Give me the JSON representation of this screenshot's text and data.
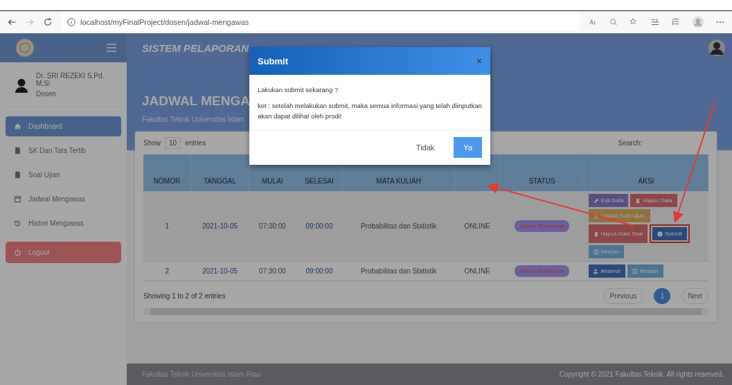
{
  "browser": {
    "url": "localhost/myFinalProject/dosen/jadwal-mengawas"
  },
  "header": {
    "title": "SISTEM PELAPORAN"
  },
  "sidebar": {
    "user": {
      "name": "Dr. SRI REZEKI S.Pd. M.Si",
      "role": "Dosen"
    },
    "items": [
      {
        "label": "Dashboard",
        "selected": true
      },
      {
        "label": "SK Dan Tata Tertib",
        "selected": false
      },
      {
        "label": "Soal Ujian",
        "selected": false
      },
      {
        "label": "Jadwal Mengawas",
        "selected": false
      },
      {
        "label": "Histori Mengawas",
        "selected": false
      }
    ],
    "logout": "Logout"
  },
  "page": {
    "title": "JADWAL MENGA",
    "subtitle": "Fakultas Teknik Universitas Islam"
  },
  "table": {
    "show_label": "Show",
    "page_size": "10",
    "entries_label": "entries",
    "search_label": "Search:",
    "columns": [
      {
        "label": "NOMOR",
        "sortable": true
      },
      {
        "label": "TANGGAL",
        "sortable": false
      },
      {
        "label": "MULAI",
        "sortable": false
      },
      {
        "label": "SELESAI",
        "sortable": false
      },
      {
        "label": "MATA KULIAH",
        "sortable": false
      },
      {
        "sortable": false
      },
      {
        "label": "STATUS",
        "sortable": true
      },
      {
        "label": "AKSI",
        "sortable": true
      }
    ],
    "rows": [
      {
        "cells": [
          "1",
          "2021-10-05",
          "07:30:00",
          "09:00:00",
          "Probabilitas dan Statistik",
          "ONLINE"
        ],
        "status": "Belum Terlaksana",
        "actions": [
          {
            "label": "Edit Data",
            "kind": "edit"
          },
          {
            "label": "Hapus Data",
            "kind": "delete"
          },
          {
            "label": "Upload Soal Ujian",
            "kind": "upload"
          },
          {
            "label": "Hapus Data Soal",
            "kind": "delete"
          },
          {
            "label": "Submit",
            "kind": "submit",
            "highlighted": true
          },
          {
            "label": "Rincian",
            "kind": "detail"
          }
        ]
      },
      {
        "cells": [
          "2",
          "2021-10-05",
          "07:30:00",
          "09:00:00",
          "Probabilitas dan Statistik",
          "ONLINE"
        ],
        "status": "Belum Terlaksana",
        "actions": [
          {
            "label": "Absensi",
            "kind": "attend"
          },
          {
            "label": "Rincian",
            "kind": "detail"
          }
        ]
      }
    ],
    "info": "Showing 1 to 2 of 2 entries",
    "pagination": [
      {
        "label": "Previous",
        "selected": false
      },
      {
        "label": "1",
        "selected": true
      },
      {
        "label": "Next",
        "selected": false
      }
    ]
  },
  "modal": {
    "title": "Submit",
    "close": "×",
    "question": "Lakukan submit sekarang ?",
    "note": "ket : setelah melakukan submit, maka semua informasi yang telah diinputkan akan dapat dilihat oleh prodi!",
    "buttons": [
      {
        "label": "Tidak",
        "kind": "secondary"
      },
      {
        "label": "Ya",
        "kind": "primary"
      }
    ]
  },
  "footer": {
    "left": "Fakultas Teknik Universitas Islam Riau",
    "right": "Copyright © 2021 Fakultas Teknik. All rights reserved."
  }
}
